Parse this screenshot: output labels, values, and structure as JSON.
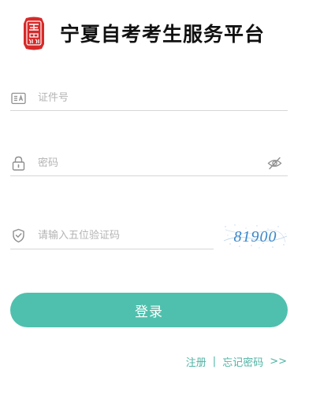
{
  "header": {
    "title": "宁夏自考考生服务平台",
    "logo_icon": "seal-logo-icon"
  },
  "form": {
    "id_number": {
      "icon": "id-card-icon",
      "placeholder": "证件号",
      "value": ""
    },
    "password": {
      "icon": "lock-icon",
      "placeholder": "密码",
      "value": "",
      "toggle_icon": "eye-hidden-icon"
    },
    "captcha": {
      "icon": "shield-check-icon",
      "placeholder": "请输入五位验证码",
      "value": "",
      "image_text": "81900"
    },
    "login_label": "登录"
  },
  "links": {
    "register": "注册",
    "separator": "|",
    "forgot_password": "忘记密码",
    "more": ">>"
  },
  "colors": {
    "accent": "#4fc0ad",
    "link": "#4fb3a4",
    "logo_red": "#d62a2a",
    "captcha_text": "#3a86c8"
  }
}
